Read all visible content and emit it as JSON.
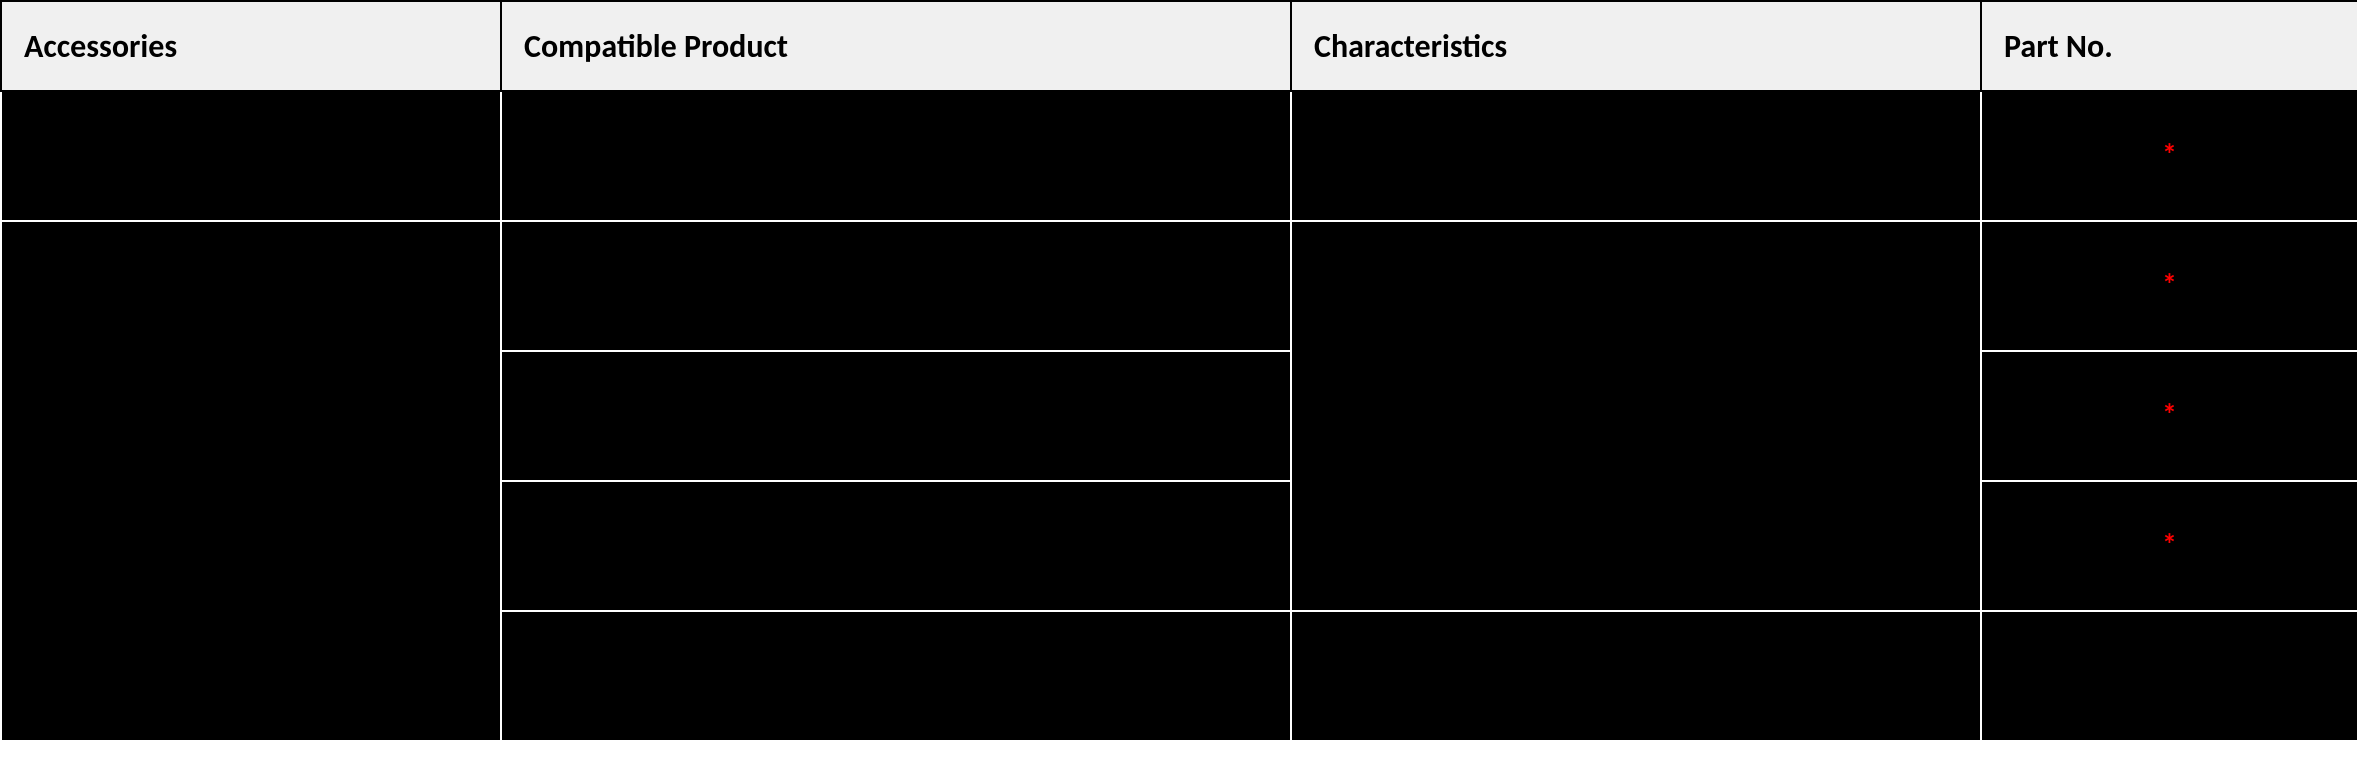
{
  "table": {
    "headers": {
      "accessories": "Accessories",
      "compatible_product": "Compatible Product",
      "characteristics": "Characteristics",
      "part_no": "Part No."
    },
    "rows": [
      {
        "accessories": "",
        "compatible_product": "",
        "characteristics": "",
        "part_no": "",
        "has_asterisk": true
      },
      {
        "accessories": "",
        "compatible_product": "",
        "characteristics": "",
        "part_no": "",
        "has_asterisk": true
      },
      {
        "accessories": "",
        "compatible_product": "",
        "characteristics": "",
        "part_no": "",
        "has_asterisk": true
      },
      {
        "accessories": "",
        "compatible_product": "",
        "characteristics": "",
        "part_no": "",
        "has_asterisk": true
      },
      {
        "accessories": "",
        "compatible_product": "",
        "characteristics": "",
        "part_no": "",
        "has_asterisk": false
      }
    ],
    "asterisk_glyph": "*"
  }
}
